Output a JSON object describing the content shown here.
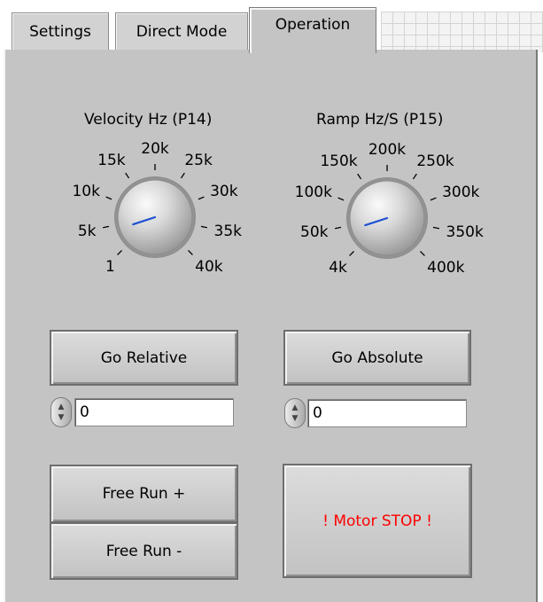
{
  "tabs": [
    {
      "label": "Settings",
      "active": false
    },
    {
      "label": "Direct Mode",
      "active": false
    },
    {
      "label": "Operation",
      "active": true
    }
  ],
  "velocity_knob": {
    "title": "Velocity Hz (P14)",
    "scale_labels": [
      "1",
      "5k",
      "10k",
      "15k",
      "20k",
      "25k",
      "30k",
      "35k",
      "40k"
    ],
    "value_fraction": 0.1
  },
  "ramp_knob": {
    "title": "Ramp Hz/S (P15)",
    "scale_labels": [
      "4k",
      "50k",
      "100k",
      "150k",
      "200k",
      "250k",
      "300k",
      "350k",
      "400k"
    ],
    "value_fraction": 0.1
  },
  "buttons": {
    "go_relative": "Go Relative",
    "go_absolute": "Go Absolute",
    "free_run_plus": "Free Run +",
    "free_run_minus": "Free Run -",
    "motor_stop": "! Motor STOP !"
  },
  "inputs": {
    "relative_value": "0",
    "absolute_value": "0"
  },
  "colors": {
    "panel": "#c4c4c4",
    "knob_pointer": "#1e50d2",
    "stop_text": "#ff0000"
  }
}
